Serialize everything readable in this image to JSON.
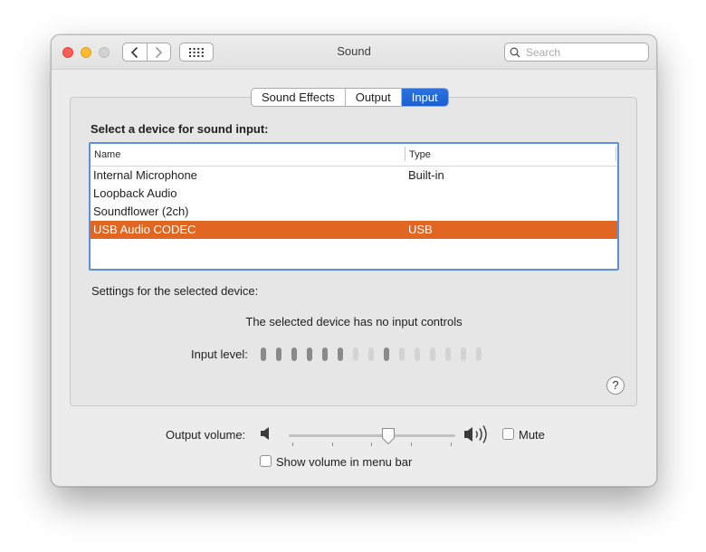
{
  "window": {
    "title": "Sound",
    "search_placeholder": "Search"
  },
  "tabs": [
    {
      "label": "Sound Effects",
      "active": false
    },
    {
      "label": "Output",
      "active": false
    },
    {
      "label": "Input",
      "active": true
    }
  ],
  "input_panel": {
    "heading": "Select a device for sound input:",
    "columns": {
      "name": "Name",
      "type": "Type"
    },
    "devices": [
      {
        "name": "Internal Microphone",
        "type": "Built-in",
        "selected": false
      },
      {
        "name": "Loopback Audio",
        "type": "",
        "selected": false
      },
      {
        "name": "Soundflower (2ch)",
        "type": "",
        "selected": false
      },
      {
        "name": "USB Audio CODEC",
        "type": "USB",
        "selected": true
      }
    ],
    "settings_label": "Settings for the selected device:",
    "no_controls_text": "The selected device has no input controls",
    "input_level_label": "Input level:",
    "input_level": {
      "total_bars": 15,
      "lit_bars": [
        1,
        2,
        3,
        4,
        5,
        6,
        9
      ]
    },
    "help_label": "?"
  },
  "output_volume": {
    "label": "Output volume:",
    "value_fraction": 0.6,
    "mute_label": "Mute",
    "mute_checked": false
  },
  "menu_bar_option": {
    "label": "Show volume in menu bar",
    "checked": false
  },
  "colors": {
    "selection": "#e06622",
    "active_tab": "#1a5fd0",
    "focus_ring": "#5d8fdf"
  },
  "icons": {
    "back": "chevron-left-icon",
    "forward": "chevron-right-icon",
    "grid": "grid-icon",
    "search": "magnifier-icon",
    "speaker_low": "speaker-low-icon",
    "speaker_high": "speaker-high-icon"
  }
}
